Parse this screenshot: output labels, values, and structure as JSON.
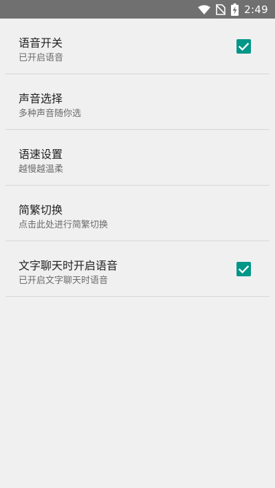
{
  "status_bar": {
    "time": "2:49",
    "icons": [
      "wifi-icon",
      "no-sim-icon",
      "battery-charging-icon"
    ]
  },
  "settings": {
    "items": [
      {
        "title": "语音开关",
        "summary": "已开启语音",
        "checked": true
      },
      {
        "title": "声音选择",
        "summary": "多种声音随你选"
      },
      {
        "title": "语速设置",
        "summary": "越慢越温柔"
      },
      {
        "title": "简繁切换",
        "summary": "点击此处进行简繁切换"
      },
      {
        "title": "文字聊天时开启语音",
        "summary": "已开启文字聊天时语音",
        "checked": true
      }
    ]
  },
  "colors": {
    "status_bar": "#707070",
    "background": "#f0f0f0",
    "accent": "#009688",
    "divider": "#d6d6d6"
  }
}
